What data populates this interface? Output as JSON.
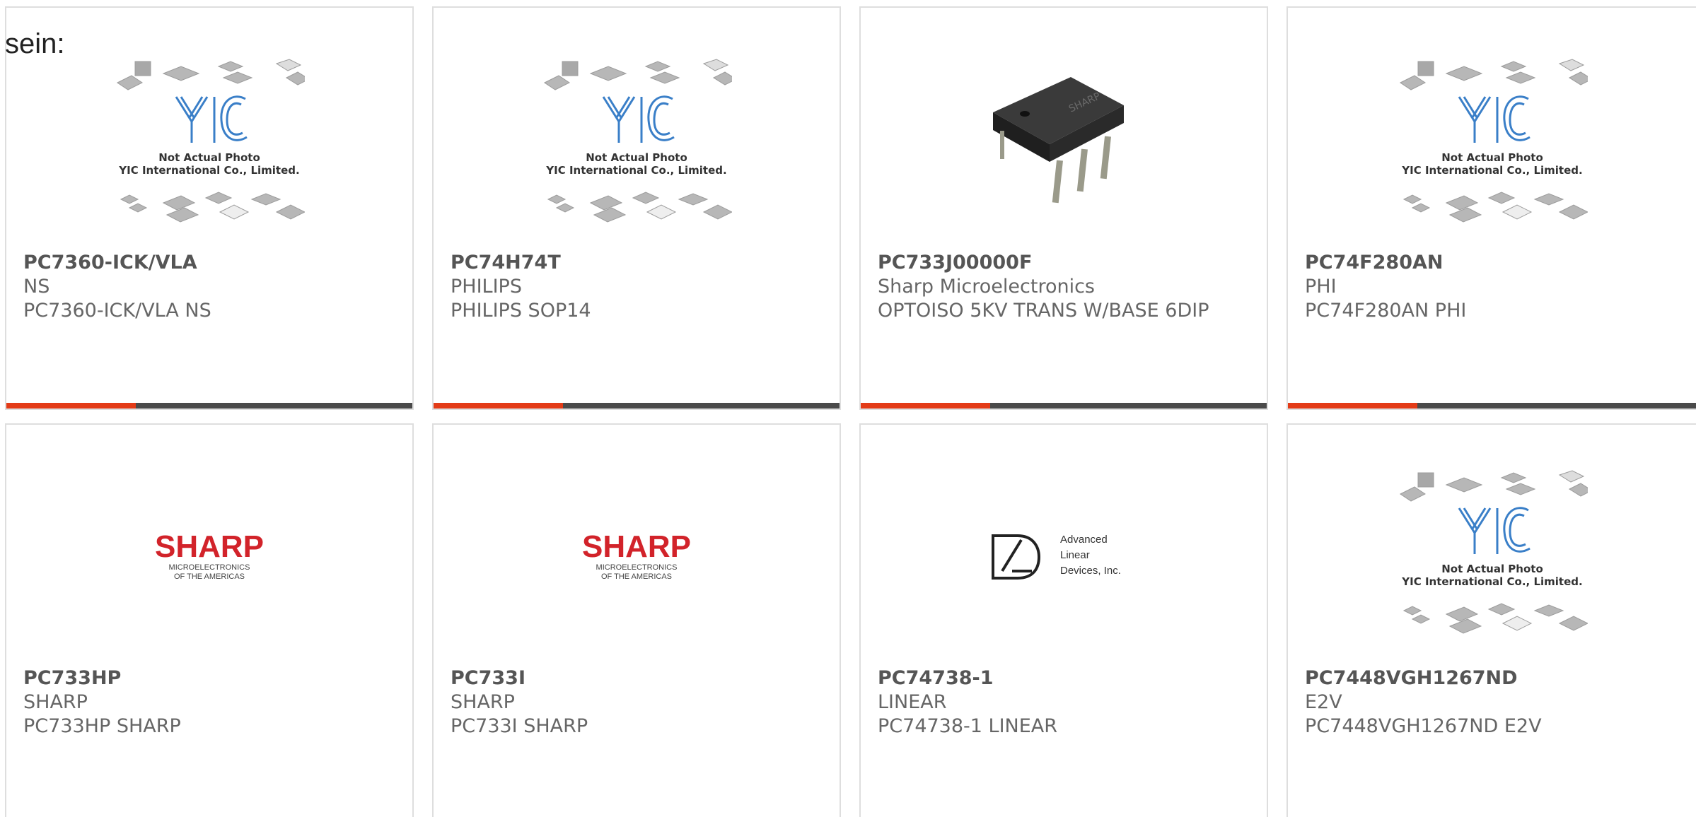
{
  "intro_text": "sein:",
  "colors": {
    "accent": "#e33b17",
    "bar": "#4a4a4a",
    "sharp_red": "#d2232a"
  },
  "placeholder_image": {
    "line1": "Not Actual Photo",
    "line2": "YIC International Co., Limited.",
    "logo": "YIC"
  },
  "sharp_logo": {
    "name": "SHARP",
    "line1": "MICROELECTRONICS",
    "line2": "OF THE AMERICAS"
  },
  "adi_logo": {
    "line1": "Advanced",
    "line2": "Linear",
    "line3": "Devices, Inc."
  },
  "products": [
    {
      "part": "PC7360-ICK/VLA",
      "brand": "NS",
      "desc": "PC7360-ICK/VLA NS",
      "image": "yic-placeholder"
    },
    {
      "part": "PC74H74T",
      "brand": "PHILIPS",
      "desc": "PHILIPS SOP14",
      "image": "yic-placeholder"
    },
    {
      "part": "PC733J00000F",
      "brand": "Sharp Microelectronics",
      "desc": "OPTOISO 5KV TRANS W/BASE 6DIP",
      "image": "sharp-dip-chip"
    },
    {
      "part": "PC74F280AN",
      "brand": "PHI",
      "desc": "PC74F280AN PHI",
      "image": "yic-placeholder"
    },
    {
      "part": "PC733HP",
      "brand": "SHARP",
      "desc": "PC733HP SHARP",
      "image": "sharp-logo"
    },
    {
      "part": "PC733I",
      "brand": "SHARP",
      "desc": "PC733I SHARP",
      "image": "sharp-logo"
    },
    {
      "part": "PC74738-1",
      "brand": "LINEAR",
      "desc": "PC74738-1 LINEAR",
      "image": "adi-logo"
    },
    {
      "part": "PC7448VGH1267ND",
      "brand": "E2V",
      "desc": "PC7448VGH1267ND E2V",
      "image": "yic-placeholder"
    }
  ]
}
